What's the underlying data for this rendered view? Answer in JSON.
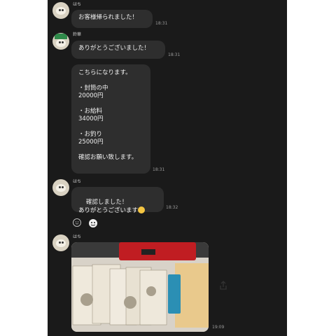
{
  "messages": [
    {
      "sender": "はち",
      "text": "お客様帰られました！",
      "time": "18:31"
    },
    {
      "sender": "鈴華",
      "text": "ありがとうございました！",
      "time": "18:31"
    },
    {
      "text": "こちらになります。\n\n・封筒の中\n20000円\n\n・お給料\n34000円\n\n・お釣り\n25000円\n\n確認お願い致します。",
      "time": "18:31"
    },
    {
      "sender": "はち",
      "text": "確認しました！\nありがとうございます",
      "time": "18:32"
    },
    {
      "sender": "はち",
      "time": "19:09"
    }
  ],
  "colors": {
    "background": "#1a1a1a",
    "bubble": "#2e2e2e",
    "text": "#f1f1f1"
  }
}
